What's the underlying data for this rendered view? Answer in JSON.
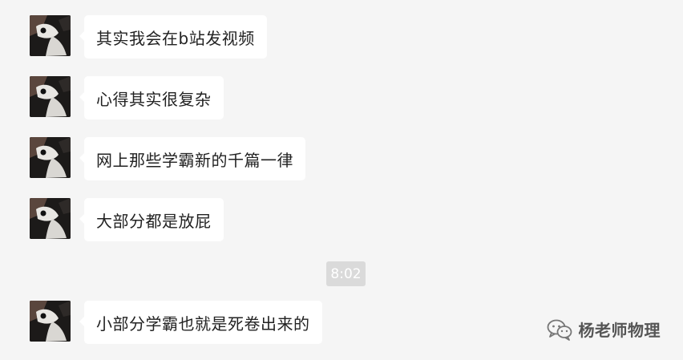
{
  "messages": [
    {
      "text": "其实我会在b站发视频"
    },
    {
      "text": "心得其实很复杂"
    },
    {
      "text": "网上那些学霸新的千篇一律"
    },
    {
      "text": "大部分都是放屁"
    },
    {
      "text": "小部分学霸也就是死卷出来的"
    }
  ],
  "timestamp": "8:02",
  "watermark": {
    "icon": "wechat-icon",
    "label": "杨老师物理"
  },
  "colors": {
    "background": "#f5f5f5",
    "bubble": "#ffffff",
    "timestamp_bg": "#dadada"
  }
}
